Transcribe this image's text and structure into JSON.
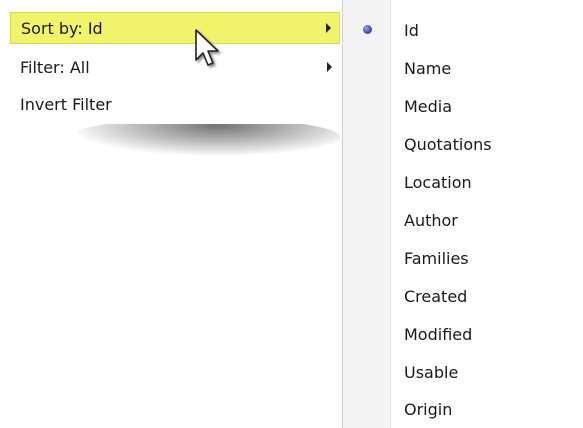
{
  "main_menu": {
    "items": [
      {
        "label": "Sort by: Id",
        "has_submenu": true,
        "highlighted": true
      },
      {
        "label": "Filter: All",
        "has_submenu": true,
        "highlighted": false
      },
      {
        "label": "Invert Filter",
        "has_submenu": false,
        "highlighted": false
      }
    ]
  },
  "sort_submenu": {
    "selected": "Id",
    "items": [
      {
        "label": "Id"
      },
      {
        "label": "Name"
      },
      {
        "label": "Media"
      },
      {
        "label": "Quotations"
      },
      {
        "label": "Location"
      },
      {
        "label": "Author"
      },
      {
        "label": "Families"
      },
      {
        "label": "Created"
      },
      {
        "label": "Modified"
      },
      {
        "label": "Usable"
      },
      {
        "label": "Origin"
      }
    ]
  },
  "colors": {
    "highlight": "#f1f36a",
    "highlight_border": "#d9db4f",
    "radio": "#4a4fb3"
  },
  "icons": {
    "submenu_arrow": "triangle-right",
    "cursor": "arrow-cursor",
    "selection": "radio-dot"
  }
}
